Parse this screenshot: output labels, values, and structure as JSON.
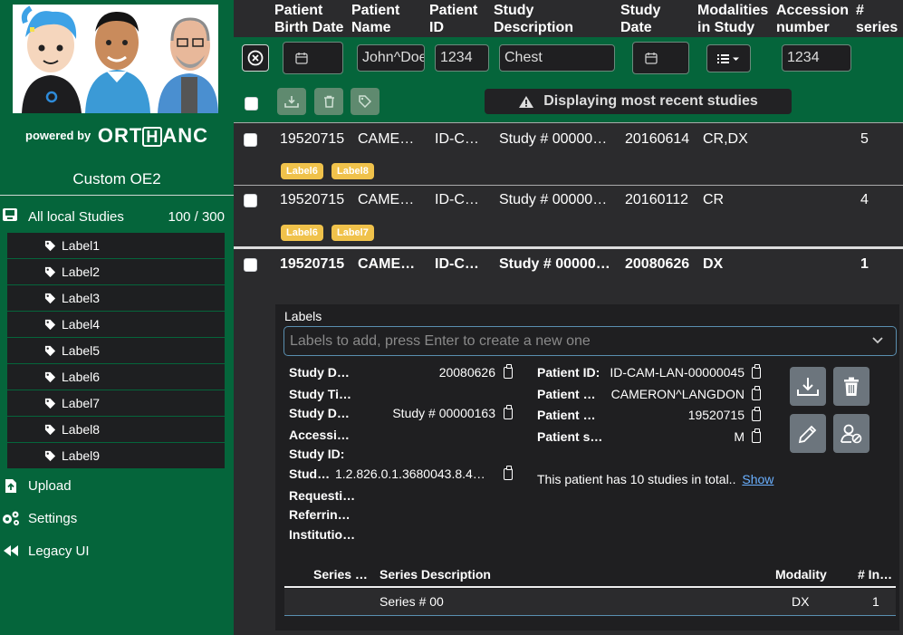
{
  "sidebar": {
    "powered_by": "powered by",
    "brand": "ORTHANC",
    "brand_pre": "ORT",
    "brand_box": "H",
    "brand_post": "ANC",
    "title": "Custom OE2",
    "all_studies": {
      "label": "All local Studies",
      "count": "100 / 300"
    },
    "labels": [
      "Label1",
      "Label2",
      "Label3",
      "Label4",
      "Label5",
      "Label6",
      "Label7",
      "Label8",
      "Label9"
    ],
    "nav": {
      "upload": "Upload",
      "settings": "Settings",
      "legacy": "Legacy UI"
    }
  },
  "columns": {
    "birth_date": [
      "Patient",
      "Birth Date"
    ],
    "name": [
      "Patient",
      "Name"
    ],
    "id": [
      "Patient",
      "ID"
    ],
    "study_desc": [
      "Study",
      "Description"
    ],
    "study_date": [
      "Study",
      "Date"
    ],
    "modalities": [
      "Modalities",
      "in Study"
    ],
    "accession": [
      "Accession",
      "number"
    ],
    "series": [
      "#",
      "series"
    ]
  },
  "filters": {
    "patient_name": "John^Doe",
    "patient_id": "1234",
    "study_description": "Chest",
    "accession": "1234"
  },
  "banner": "Displaying most recent studies",
  "studies": [
    {
      "birth": "19520715",
      "name": "CAME…",
      "id": "ID-C…",
      "desc": "Study # 00000…",
      "date": "20160614",
      "mods": "CR,DX",
      "series": "5",
      "labels": [
        "Label6",
        "Label8"
      ]
    },
    {
      "birth": "19520715",
      "name": "CAME…",
      "id": "ID-C…",
      "desc": "Study # 00000…",
      "date": "20160112",
      "mods": "CR",
      "series": "4",
      "labels": [
        "Label6",
        "Label7"
      ]
    },
    {
      "birth": "19520715",
      "name": "CAME…",
      "id": "ID-C…",
      "desc": "Study # 00000…",
      "date": "20080626",
      "mods": "DX",
      "series": "1",
      "labels": []
    }
  ],
  "detail": {
    "labels_title": "Labels",
    "labels_placeholder": "Labels to add, press Enter to create a new one",
    "study_fields": [
      {
        "label": "Study D…",
        "value": "20080626",
        "clip": true
      },
      {
        "label": "Study Ti…",
        "value": "",
        "clip": false
      },
      {
        "label": "Study D…",
        "value": "Study # 00000163",
        "clip": true
      },
      {
        "label": "Accessi…",
        "value": "",
        "clip": false
      },
      {
        "label": "Study ID:",
        "value": "",
        "clip": false
      },
      {
        "label": "Stud…",
        "value": "1.2.826.0.1.3680043.8.4…",
        "clip": true
      },
      {
        "label": "Requesti…",
        "value": "",
        "clip": false
      },
      {
        "label": "Referrin…",
        "value": "",
        "clip": false
      },
      {
        "label": "Institutio…",
        "value": "",
        "clip": false
      }
    ],
    "patient_fields": [
      {
        "label": "Patient ID:",
        "value": "ID-CAM-LAN-00000045"
      },
      {
        "label": "Patient …",
        "value": "CAMERON^LANGDON"
      },
      {
        "label": "Patient …",
        "value": "19520715"
      },
      {
        "label": "Patient s…",
        "value": "M"
      }
    ],
    "patient_note": "This patient has 10 studies in total..",
    "show_link": "Show",
    "series_headers": {
      "number": "Series …",
      "description": "Series Description",
      "modality": "Modality",
      "instances": "# In…"
    },
    "series": [
      {
        "number": "",
        "description": "Series # 00",
        "modality": "DX",
        "instances": "1"
      }
    ]
  }
}
